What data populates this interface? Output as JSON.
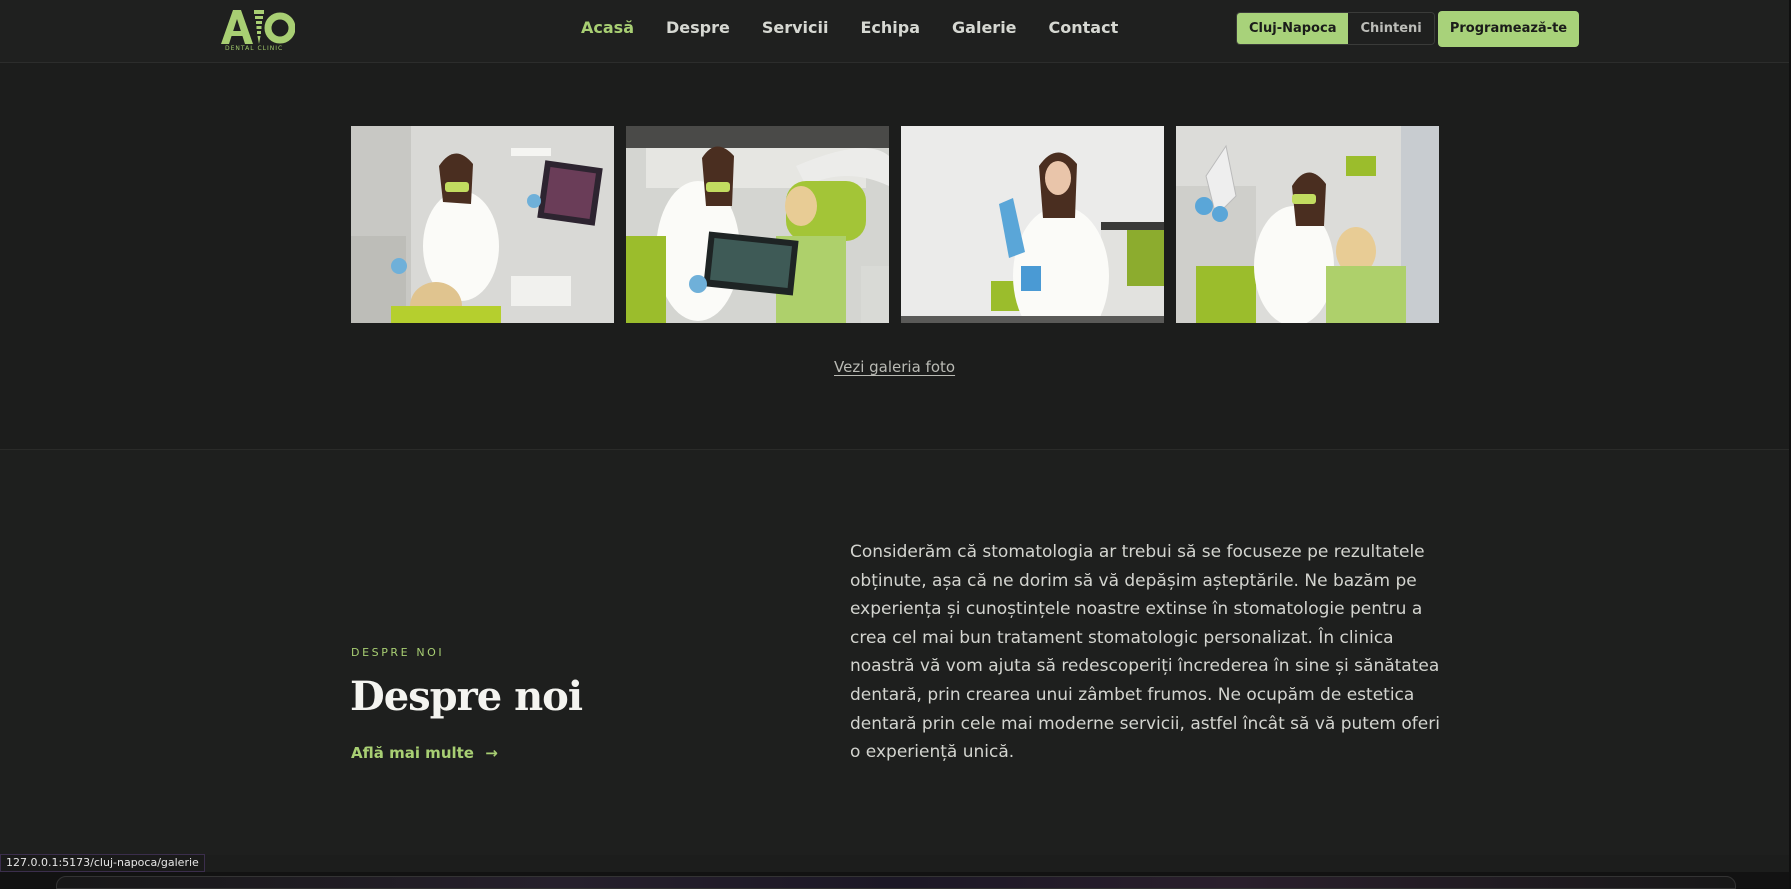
{
  "header": {
    "logo_text": "AIO",
    "logo_sub": "DENTAL CLINIC",
    "nav": [
      "Acasă",
      "Despre",
      "Servicii",
      "Echipa",
      "Galerie",
      "Contact"
    ],
    "active_nav": "Acasă",
    "locations": [
      "Cluj-Napoca",
      "Chinteni"
    ],
    "selected_location": "Cluj-Napoca",
    "cta": "Programează-te"
  },
  "gallery": {
    "photos": [
      "dentist-showing-xray-screen",
      "dentist-holding-xray-with-patient",
      "dentist-putting-on-gloves",
      "dentist-holding-xray-sheet-with-patient"
    ],
    "link": "Vezi galeria foto"
  },
  "about": {
    "eyebrow": "DESPRE NOI",
    "title": "Despre noi",
    "link": "Află mai multe",
    "link_arrow": "→",
    "text": "Considerăm că stomatologia ar trebui să se focuseze pe rezultatele obținute, așa că ne dorim să vă depășim așteptările. Ne bazăm pe experiența și cunoștințele noastre extinse în stomatologie pentru a crea cel mai bun tratament stomatologic personalizat. În clinica noastră vă vom ajuta să redescoperiți încrederea în sine și sănătatea dentară, prin crearea unui zâmbet frumos. Ne ocupăm de estetica dentară prin cele mai moderne servicii, astfel încât să vă putem oferi o experiență unică."
  },
  "status_url": "127.0.0.1:5173/cluj-napoca/galerie",
  "colors": {
    "accent": "#a8d27a",
    "background": "#1c1d1c"
  }
}
